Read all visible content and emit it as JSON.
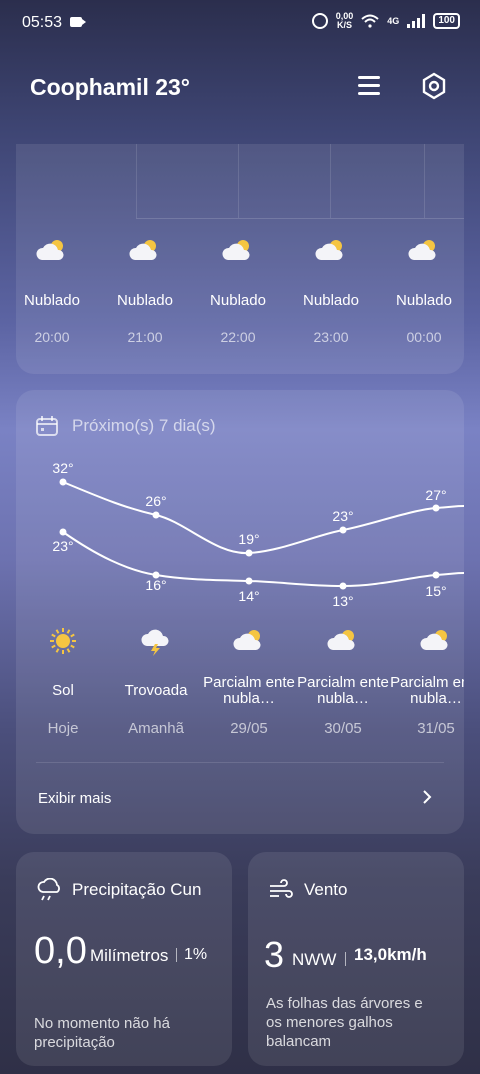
{
  "status": {
    "time": "05:53",
    "speed_value": "0,00",
    "speed_unit": "K/S",
    "network": "4G",
    "battery": "100"
  },
  "header": {
    "title": "Coophamil 23°"
  },
  "hourly": [
    {
      "cond": "Nublado",
      "time": "20:00",
      "icon": "cloud-sun-icon"
    },
    {
      "cond": "Nublado",
      "time": "21:00",
      "icon": "cloud-sun-icon"
    },
    {
      "cond": "Nublado",
      "time": "22:00",
      "icon": "cloud-sun-icon"
    },
    {
      "cond": "Nublado",
      "time": "23:00",
      "icon": "cloud-sun-icon"
    },
    {
      "cond": "Nublado",
      "time": "00:00",
      "icon": "cloud-sun-icon"
    }
  ],
  "weekly": {
    "title": "Próximo(s) 7 dia(s)",
    "days": [
      {
        "cond": "Sol",
        "date": "Hoje",
        "high": "32°",
        "low": "23°",
        "icon": "sun-icon"
      },
      {
        "cond": "Trovoada",
        "date": "Amanhã",
        "high": "26°",
        "low": "16°",
        "icon": "thunderstorm-icon"
      },
      {
        "cond": "Parcialm ente nubla…",
        "date": "29/05",
        "high": "19°",
        "low": "14°",
        "icon": "partly-cloudy-icon"
      },
      {
        "cond": "Parcialm ente nubla…",
        "date": "30/05",
        "high": "23°",
        "low": "13°",
        "icon": "partly-cloudy-icon"
      },
      {
        "cond": "Parcialm ente nubla…",
        "date": "31/05",
        "high": "27°",
        "low": "15°",
        "icon": "partly-cloudy-icon"
      }
    ],
    "more": "Exibir mais"
  },
  "precip": {
    "title": "Precipitação Cun",
    "value": "0,0",
    "unit": "Milímetros",
    "pct": "1%",
    "desc": "No momento não há precipitação"
  },
  "wind": {
    "title": "Vento",
    "value": "3",
    "dir": "NWW",
    "speed": "13,0km/h",
    "desc": "As folhas das árvores e os menores galhos balançam"
  },
  "colors": {
    "accent": "#7a82c4",
    "sun": "#f5c542"
  }
}
